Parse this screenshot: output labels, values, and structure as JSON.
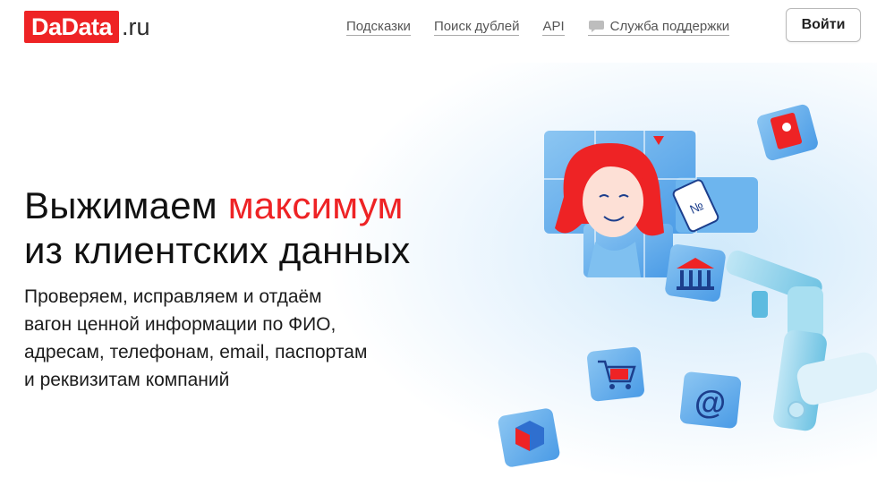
{
  "logo": {
    "brand": "DaData",
    "tld": ".ru"
  },
  "nav": {
    "items": [
      {
        "label": "Подсказки"
      },
      {
        "label": "Поиск дублей"
      },
      {
        "label": "API"
      },
      {
        "label": "Служба поддержки",
        "icon": "chat-bubble-icon"
      }
    ],
    "login_label": "Войти"
  },
  "hero": {
    "title_part1": "Выжимаем ",
    "title_accent": "максимум",
    "title_line2": "из клиентских данных",
    "subtitle_lines": [
      "Проверяем, исправляем и отдаём",
      "вагон ценной информации по ФИО,",
      "адресам, телефонам, email, паспортам",
      "и реквизитам компаний"
    ]
  },
  "illustration": {
    "icons": [
      "puzzle-portrait-icon",
      "passport-icon",
      "bank-icon",
      "shopping-cart-icon",
      "at-sign-icon",
      "parcel-icon",
      "robot-arm-icon",
      "phone-icon"
    ]
  },
  "colors": {
    "brand_red": "#ee2325",
    "puzzle_blue": "#5aa8e8",
    "puzzle_dark": "#2f6fcf"
  }
}
